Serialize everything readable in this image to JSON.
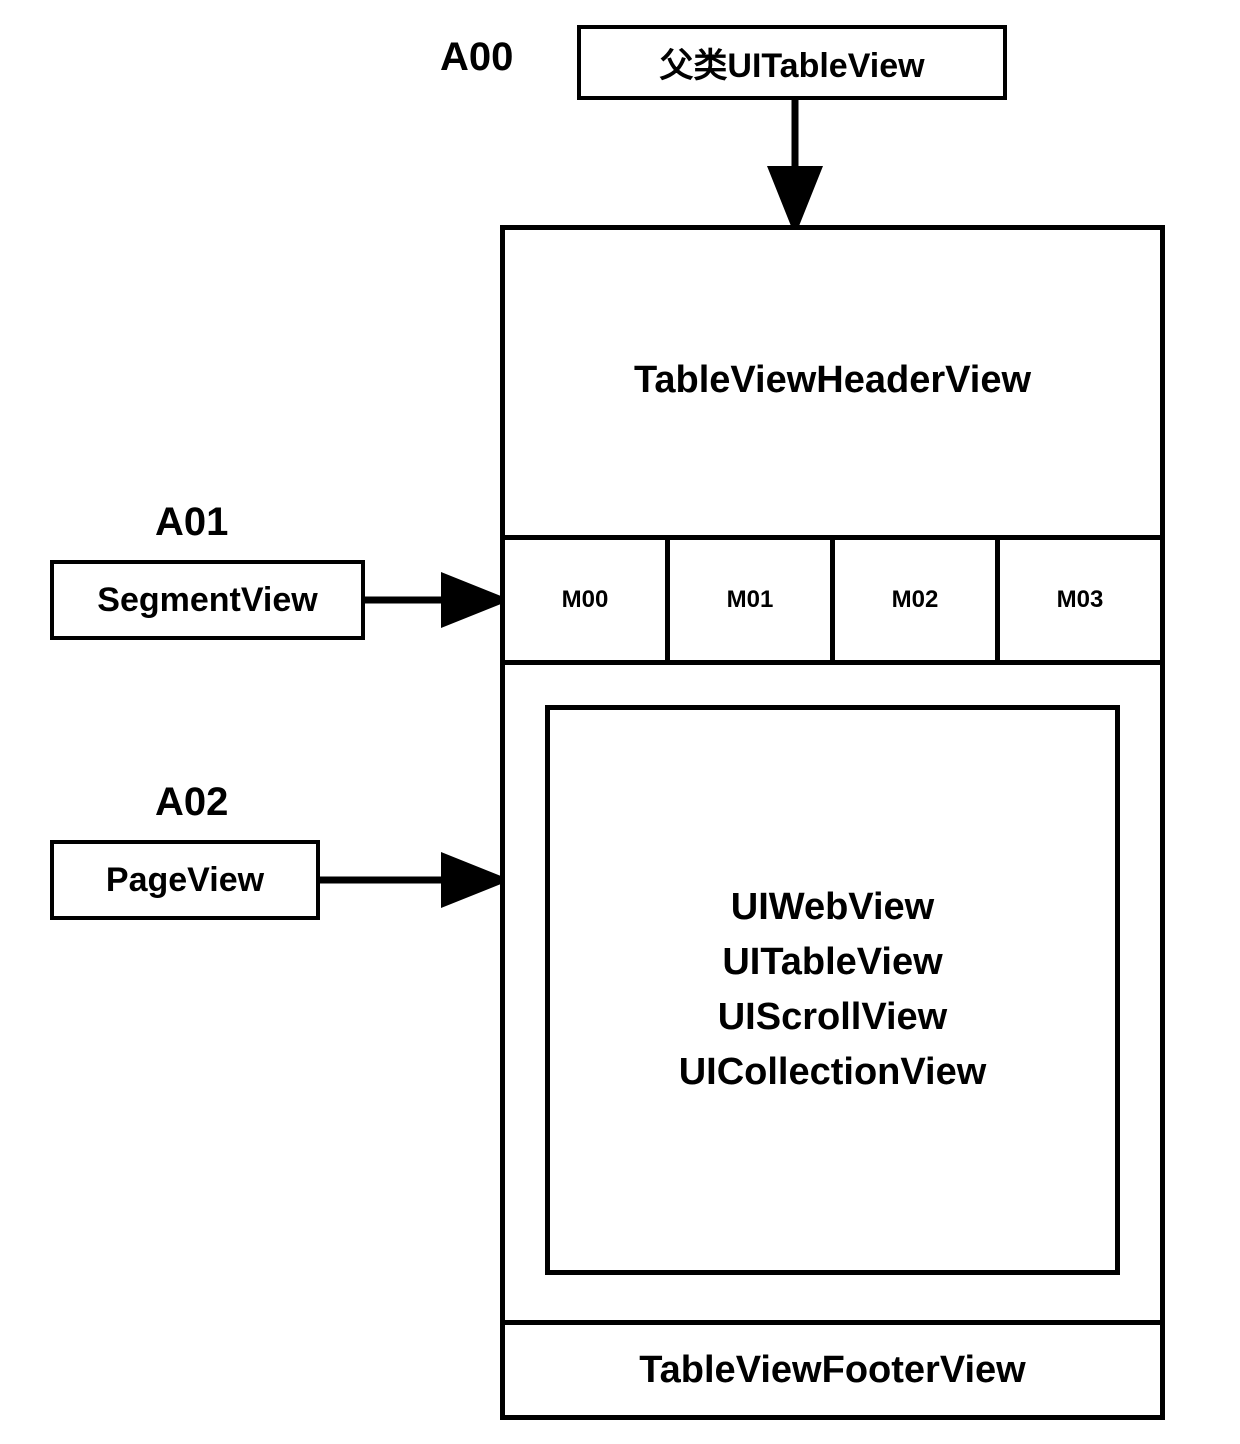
{
  "parent": {
    "id_label": "A00",
    "box_label": "父类UITableView"
  },
  "segment": {
    "id_label": "A01",
    "box_label": "SegmentView"
  },
  "page": {
    "id_label": "A02",
    "box_label": "PageView"
  },
  "main": {
    "header": "TableViewHeaderView",
    "segments": [
      "M00",
      "M01",
      "M02",
      "M03"
    ],
    "page_content": [
      "UIWebView",
      "UITableView",
      "UIScrollView",
      "UICollectionView"
    ],
    "footer": "TableViewFooterView"
  }
}
